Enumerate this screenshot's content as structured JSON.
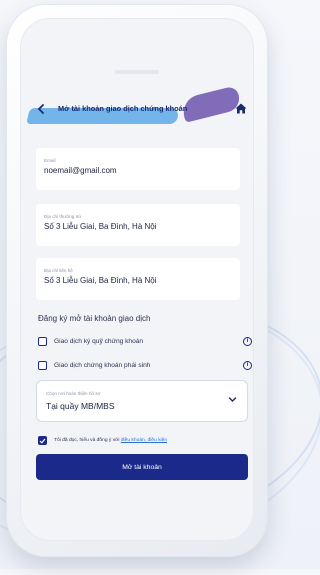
{
  "header": {
    "back_icon": "chevron-left-icon",
    "title": "Mở tài khoản giao dịch chứng khoán",
    "home_icon": "home-icon"
  },
  "fields": [
    {
      "label": "Email",
      "value": "noemail@gmail.com"
    },
    {
      "label": "Địa chỉ thường trú",
      "value": "Số 3 Liễu Giai, Ba Đình, Hà Nội"
    },
    {
      "label": "Địa chỉ liên hệ",
      "value": "Số 3 Liễu Giai, Ba Đình, Hà Nội"
    }
  ],
  "register": {
    "title": "Đăng ký mở tài khoản giao dịch",
    "options": [
      {
        "label": "Giao dịch ký quỹ chứng khoán",
        "checked": false
      },
      {
        "label": "Giao dịch chứng khoán phái sinh",
        "checked": false
      }
    ]
  },
  "select": {
    "label": "Chọn nơi hoàn thiện hồ sơ",
    "value": "Tại quầy MB/MBS"
  },
  "agreement": {
    "checked": true,
    "text": "Tôi đã đọc, hiểu và đồng ý với",
    "link": "điều khoản, điều kiện"
  },
  "submit_label": "Mở tài khoản",
  "colors": {
    "primary": "#1b2a8a",
    "link": "#2a6fd6",
    "screen_bg": "#f3f4f8"
  }
}
